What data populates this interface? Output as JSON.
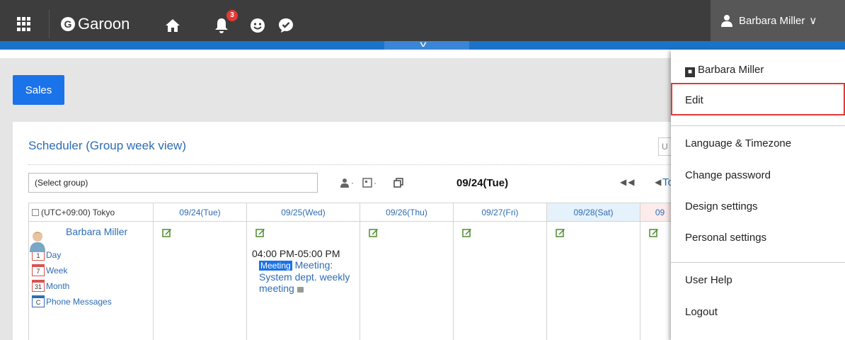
{
  "header": {
    "app_name": "Garoon",
    "logo_letter": "G",
    "notification_count": "3",
    "user_name": "Barbara Miller",
    "accent_color": "#1a73c8"
  },
  "content": {
    "sales_button": "Sales",
    "portlet_title": "Scheduler (Group week view)",
    "search_stub": "U",
    "group_select": "(Select group)",
    "current_date": "09/24(Tue)",
    "today_link": "To",
    "timezone": "(UTC+09:00) Tokyo",
    "days": [
      "09/24(Tue)",
      "09/25(Wed)",
      "09/26(Thu)",
      "09/27(Fri)",
      "09/28(Sat)",
      "09"
    ],
    "user": {
      "name": "Barbara Miller",
      "links": [
        {
          "label": "Day",
          "icon_text": "1"
        },
        {
          "label": "Week",
          "icon_text": "7"
        },
        {
          "label": "Month",
          "icon_text": "31"
        },
        {
          "label": "Phone Messages",
          "icon_text": "C"
        }
      ]
    },
    "event": {
      "time": "04:00 PM-05:00 PM",
      "tag": "Meeting",
      "title": "Meeting: System dept. weekly meeting"
    }
  },
  "dropdown": {
    "user_name": "Barbara Miller",
    "items": [
      "Edit",
      "Language & Timezone",
      "Change password",
      "Design settings",
      "Personal settings",
      "User Help",
      "Logout"
    ]
  }
}
